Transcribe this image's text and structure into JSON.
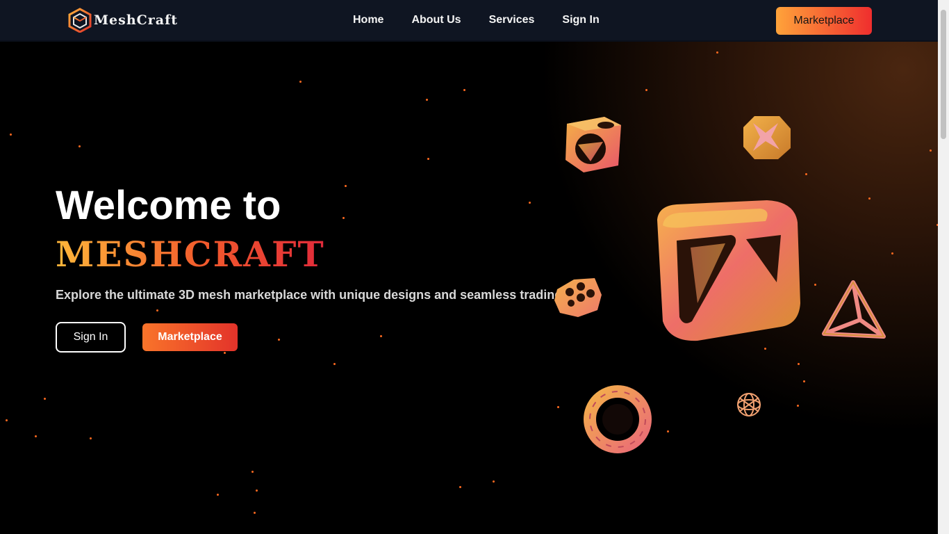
{
  "nav": {
    "brand": "MeshCraft",
    "links": [
      {
        "label": "Home"
      },
      {
        "label": "About Us"
      },
      {
        "label": "Services"
      },
      {
        "label": "Sign In"
      }
    ],
    "cta_label": "Marketplace"
  },
  "hero": {
    "heading": "Welcome to",
    "brand_title": "MESHCRAFT",
    "subtitle": "Explore the ultimate 3D mesh marketplace with unique designs and seamless trading.",
    "signin_label": "Sign In",
    "marketplace_label": "Marketplace"
  },
  "colors": {
    "accent_orange": "#ff8a2a",
    "accent_red": "#e6302a",
    "nav_bg": "#0f1522",
    "particle": "#ff6a1f"
  },
  "icons": {
    "logo": "meshcraft-cube-logo"
  }
}
